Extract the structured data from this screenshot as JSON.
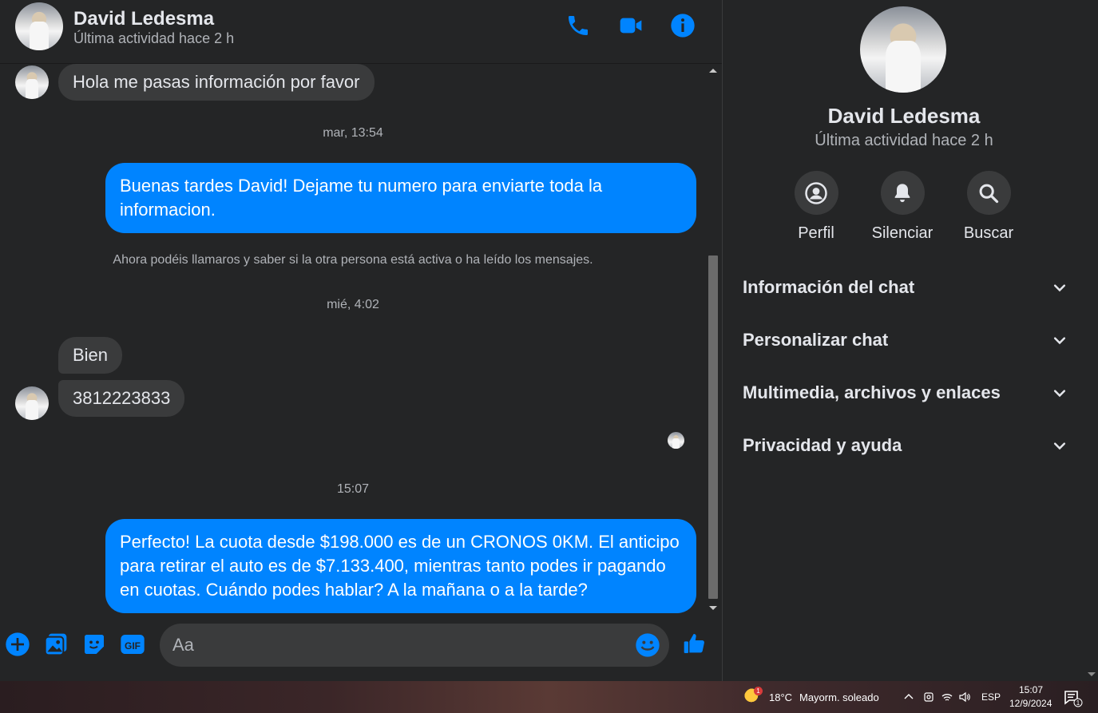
{
  "header": {
    "name": "David Ledesma",
    "status": "Última actividad hace 2 h"
  },
  "messages": {
    "m1": "Hola me pasas información por favor",
    "ts1": "mar, 13:54",
    "m2": "Buenas tardes David! Dejame tu numero para enviarte toda la informacion.",
    "system_note": "Ahora podéis llamaros y saber si la otra persona está activa o ha leído los mensajes.",
    "ts2": "mié, 4:02",
    "m3": "Bien",
    "m4": "3812223833",
    "ts3": "15:07",
    "m5": "Perfecto! La cuota desde $198.000 es de un CRONOS 0KM. El anticipo para retirar el auto es de $7.133.400, mientras tanto podes ir pagando en cuotas. Cuándo podes hablar? A la mañana o a la tarde?"
  },
  "composer": {
    "placeholder": "Aa"
  },
  "side": {
    "name": "David Ledesma",
    "status": "Última actividad hace 2 h",
    "actions": [
      {
        "label": "Perfil",
        "icon": "profile-icon"
      },
      {
        "label": "Silenciar",
        "icon": "bell-icon"
      },
      {
        "label": "Buscar",
        "icon": "search-icon"
      }
    ],
    "sections": [
      {
        "title": "Información del chat"
      },
      {
        "title": "Personalizar chat"
      },
      {
        "title": "Multimedia, archivos y enlaces"
      },
      {
        "title": "Privacidad y ayuda"
      }
    ]
  },
  "taskbar": {
    "temperature": "18°C",
    "weather": "Mayorm. soleado",
    "weather_badge": "1",
    "language": "ESP",
    "time": "15:07",
    "date": "12/9/2024",
    "notifications": "1"
  },
  "colors": {
    "accent": "#0084ff",
    "background": "#242526",
    "bubble_in": "#3a3b3c"
  }
}
